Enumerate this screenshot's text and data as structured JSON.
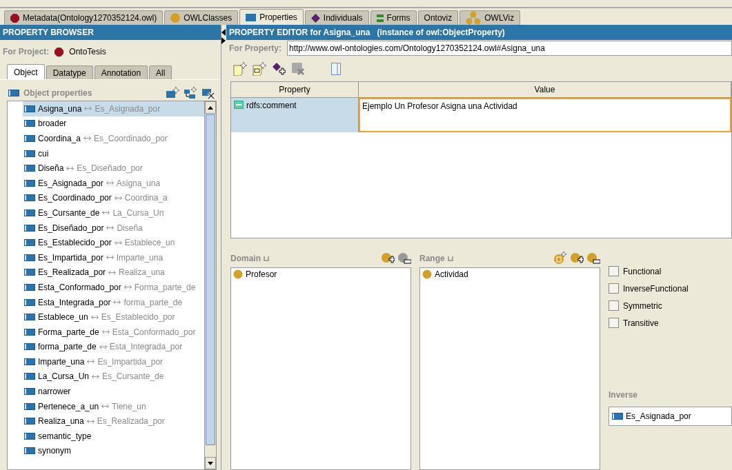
{
  "tabs": [
    {
      "label": "Metadata(Ontology1270352124.owl)",
      "kind": "hexagon",
      "selected": false
    },
    {
      "label": "OWLClasses",
      "kind": "circle",
      "selected": false
    },
    {
      "label": "Properties",
      "kind": "property",
      "selected": true
    },
    {
      "label": "Individuals",
      "kind": "diamond",
      "selected": false
    },
    {
      "label": "Forms",
      "kind": "bars",
      "selected": false
    },
    {
      "label": "Ontoviz",
      "kind": "plain",
      "selected": false
    },
    {
      "label": "OWLViz",
      "kind": "graph",
      "selected": false
    }
  ],
  "browser": {
    "title": "PROPERTY BROWSER",
    "project_label": "For Project:",
    "project_name": "OntoTesis",
    "subtabs": [
      {
        "label": "Object",
        "selected": true
      },
      {
        "label": "Datatype",
        "selected": false
      },
      {
        "label": "Annotation",
        "selected": false
      },
      {
        "label": "All",
        "selected": false
      }
    ],
    "section_title": "Object properties",
    "properties": [
      {
        "name": "Asigna_una",
        "inverse": "Es_Asignada_por",
        "selected": true
      },
      {
        "name": "broader",
        "selected": false
      },
      {
        "name": "Coordina_a",
        "inverse": "Es_Coordinado_por",
        "selected": false
      },
      {
        "name": "cui",
        "selected": false
      },
      {
        "name": "Diseña",
        "inverse": "Es_Diseñado_por",
        "selected": false
      },
      {
        "name": "Es_Asignada_por",
        "inverse": "Asigna_una",
        "selected": false
      },
      {
        "name": "Es_Coordinado_por",
        "inverse": "Coordina_a",
        "selected": false
      },
      {
        "name": "Es_Cursante_de",
        "inverse": "La_Cursa_Un",
        "selected": false
      },
      {
        "name": "Es_Diseñado_por",
        "inverse": "Diseña",
        "selected": false
      },
      {
        "name": "Es_Establecido_por",
        "inverse": "Establece_un",
        "selected": false
      },
      {
        "name": "Es_Impartida_por",
        "inverse": "Imparte_una",
        "selected": false
      },
      {
        "name": "Es_Realizada_por",
        "inverse": "Realiza_una",
        "selected": false
      },
      {
        "name": "Esta_Conformado_por",
        "inverse": "Forma_parte_de",
        "selected": false
      },
      {
        "name": "Esta_Integrada_por",
        "inverse": "forma_parte_de",
        "selected": false
      },
      {
        "name": "Establece_un",
        "inverse": "Es_Establecido_por",
        "selected": false
      },
      {
        "name": "Forma_parte_de",
        "inverse": "Esta_Conformado_por",
        "selected": false
      },
      {
        "name": "forma_parte_de",
        "inverse": "Esta_Integrada_por",
        "selected": false
      },
      {
        "name": "Imparte_una",
        "inverse": "Es_Impartida_por",
        "selected": false
      },
      {
        "name": "La_Cursa_Un",
        "inverse": "Es_Cursante_de",
        "selected": false
      },
      {
        "name": "narrower",
        "selected": false
      },
      {
        "name": "Pertenece_a_un",
        "inverse": "Tiene_un",
        "selected": false
      },
      {
        "name": "Realiza_una",
        "inverse": "Es_Realizada_por",
        "selected": false
      },
      {
        "name": "semantic_type",
        "selected": false
      },
      {
        "name": "synonym",
        "selected": false
      }
    ]
  },
  "editor": {
    "title": "PROPERTY EDITOR for Asigna_una   (instance of owl:ObjectProperty)",
    "property_label": "For Property:",
    "uri": "http://www.owl-ontologies.com/Ontology1270352124.owl#Asigna_una",
    "table": {
      "columns": [
        "Property",
        "Value"
      ],
      "rows": [
        {
          "property": "rdfs:comment",
          "value": "Ejemplo Un Profesor Asigna una Actividad"
        }
      ]
    },
    "domain": {
      "label": "Domain",
      "items": [
        "Profesor"
      ]
    },
    "range": {
      "label": "Range",
      "items": [
        "Actividad"
      ]
    },
    "characteristics": [
      {
        "label": "Functional",
        "checked": false
      },
      {
        "label": "InverseFunctional",
        "checked": false
      },
      {
        "label": "Symmetric",
        "checked": false
      },
      {
        "label": "Transitive",
        "checked": false
      }
    ],
    "inverse": {
      "label": "Inverse",
      "value": "Es_Asignada_por"
    }
  }
}
